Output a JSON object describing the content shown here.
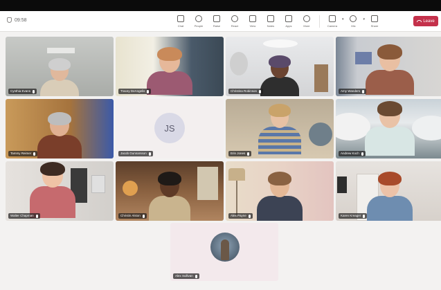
{
  "toolbar": {
    "timer": "09:58",
    "tools": [
      {
        "label": "Chat",
        "icon": "chat-icon"
      },
      {
        "label": "People",
        "icon": "people-icon"
      },
      {
        "label": "Raise",
        "icon": "hand-icon"
      },
      {
        "label": "React",
        "icon": "react-icon"
      },
      {
        "label": "View",
        "icon": "view-icon"
      },
      {
        "label": "Notes",
        "icon": "notes-icon"
      },
      {
        "label": "Apps",
        "icon": "apps-icon"
      },
      {
        "label": "More",
        "icon": "more-icon"
      }
    ],
    "camera_label": "Camera",
    "mic_label": "Mic",
    "share_label": "Share",
    "leave_label": "Leave"
  },
  "participants": [
    {
      "name": "Cynthia Evans",
      "initials": ""
    },
    {
      "name": "Tracey DeAngelis",
      "initials": ""
    },
    {
      "name": "Christina Robinson",
      "initials": ""
    },
    {
      "name": "Amy Wanders",
      "initials": ""
    },
    {
      "name": "Tammy Reimer",
      "initials": ""
    },
    {
      "name": "Jacob Gunnarsson",
      "initials": "JS"
    },
    {
      "name": "Erin Jones",
      "initials": ""
    },
    {
      "name": "Andrew Koch",
      "initials": ""
    },
    {
      "name": "Walter Chapman",
      "initials": ""
    },
    {
      "name": "Christin Alston",
      "initials": ""
    },
    {
      "name": "Alex Payne",
      "initials": ""
    },
    {
      "name": "Karen Kreager",
      "initials": ""
    },
    {
      "name": "Alex Sullivan",
      "initials": ""
    }
  ],
  "colors": {
    "leave": "#c4314b",
    "background": "#f3f2f1"
  }
}
